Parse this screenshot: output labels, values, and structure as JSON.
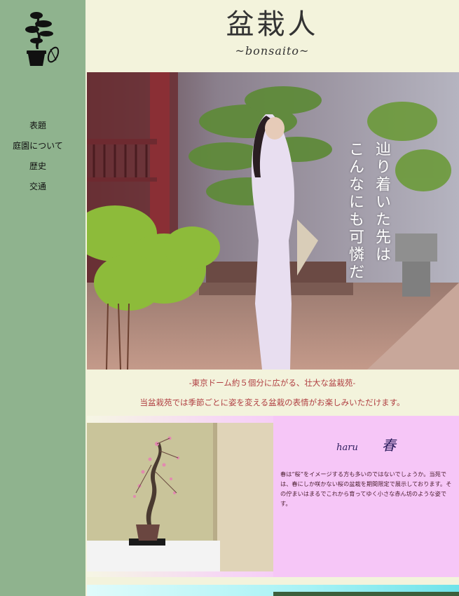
{
  "nav": {
    "items": [
      {
        "label": "表題"
      },
      {
        "label": "庭園について"
      },
      {
        "label": "歴史"
      },
      {
        "label": "交通"
      }
    ]
  },
  "header": {
    "title": "盆栽人",
    "subtitle": "~bonsaito~"
  },
  "hero": {
    "caption_lines": [
      "辿り着いた先は",
      "こんなにも可憐だ"
    ]
  },
  "intro": {
    "tagline": "-東京ドーム約５個分に広がる、壮大な盆栽苑-",
    "description": "当盆栽苑では季節ごとに姿を変える盆栽の表情がお楽しみいただけます。"
  },
  "season": {
    "romaji": "haru",
    "kanji": "春",
    "text": "春は“桜”をイメージする方も多いのではないでしょうか。当苑では、春にしか咲かない桜の盆栽を期間限定で展示しております。その佇まいはまるでこれから育ってゆく小さな赤ん坊のような姿です。"
  },
  "colors": {
    "sidebar": "#8fb38e",
    "background": "#f3f3dc",
    "accent_red": "#b03f42",
    "season_panel": "#f6c6f7"
  },
  "icons": [
    "bonsai-logo-icon"
  ]
}
